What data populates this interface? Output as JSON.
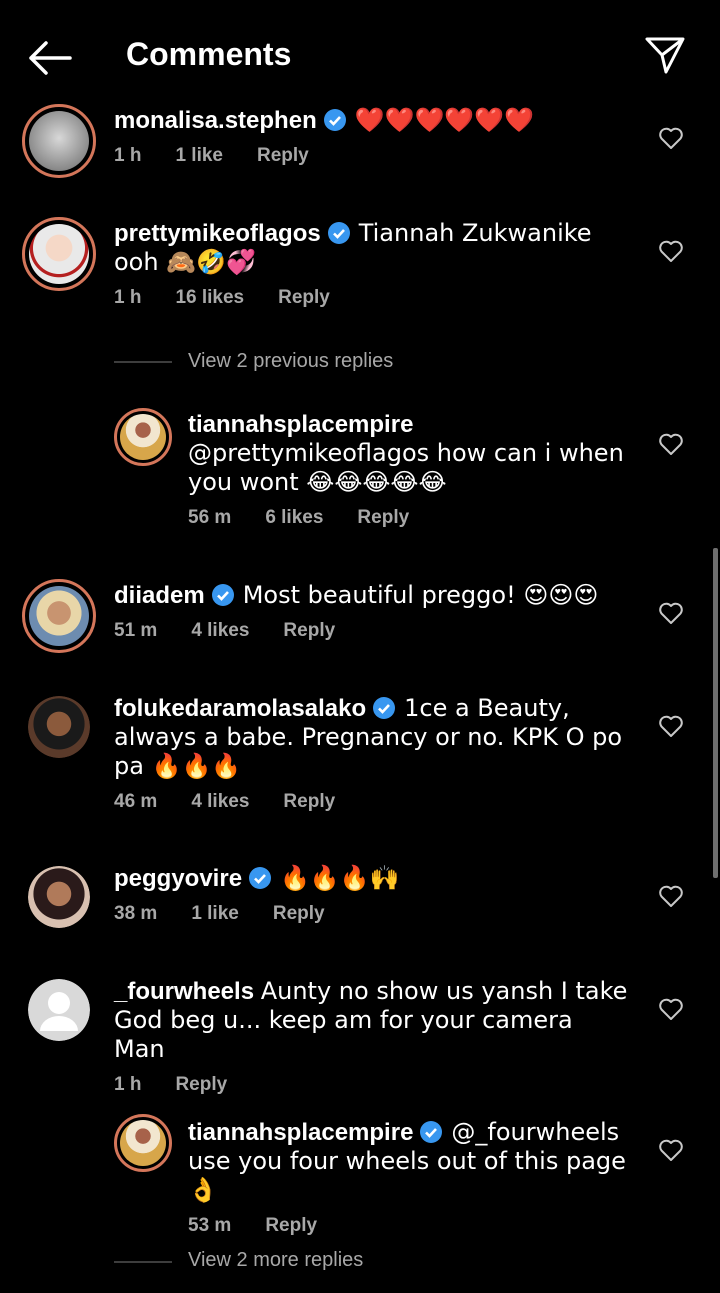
{
  "header": {
    "title": "Comments"
  },
  "comments": [
    {
      "user": "monalisa.stephen",
      "verified": true,
      "text": "❤️❤️❤️❤️❤️❤️",
      "time": "1 h",
      "likes": "1 like",
      "reply": "Reply"
    },
    {
      "user": "prettymikeoflagos",
      "verified": true,
      "text": "Tiannah Zukwanike ooh 🙈🤣💞",
      "time": "1 h",
      "likes": "16 likes",
      "reply": "Reply"
    },
    {
      "user": "tiannahsplacempire",
      "verified": false,
      "text": "@prettymikeoflagos how can i when you wont 😂😂😂😂😂",
      "time": "56 m",
      "likes": "6 likes",
      "reply": "Reply"
    },
    {
      "user": "diiadem",
      "verified": true,
      "text": "Most beautiful preggo! 😍😍😍",
      "time": "51 m",
      "likes": "4 likes",
      "reply": "Reply"
    },
    {
      "user": "folukedaramolasalako",
      "verified": true,
      "text": "1ce a Beauty, always a babe. Pregnancy or no. KPK O po pa 🔥🔥🔥",
      "time": "46 m",
      "likes": "4 likes",
      "reply": "Reply"
    },
    {
      "user": "peggyovire",
      "verified": true,
      "text": "🔥🔥🔥🙌",
      "time": "38 m",
      "likes": "1 like",
      "reply": "Reply"
    },
    {
      "user": "_fourwheels",
      "verified": false,
      "text": "Aunty no show us yansh I take God beg u... keep am for your camera Man",
      "time": "1 h",
      "likes": "",
      "reply": "Reply"
    },
    {
      "user": "tiannahsplacempire",
      "verified": true,
      "text": "@_fourwheels use you four wheels out of this page 👌",
      "time": "53 m",
      "likes": "",
      "reply": "Reply"
    }
  ],
  "view_previous": "View 2 previous replies",
  "view_more": "View 2 more replies"
}
